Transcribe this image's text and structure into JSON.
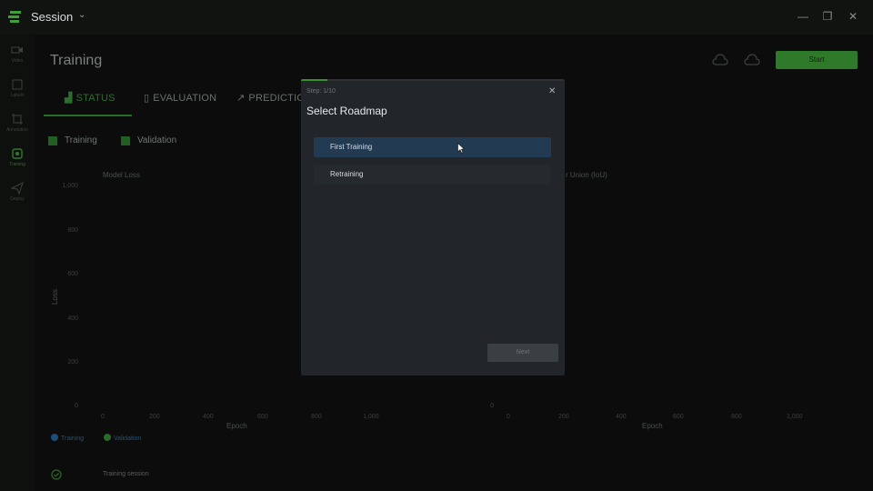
{
  "app": {
    "title": "Session"
  },
  "rail": {
    "items": [
      {
        "label": "Video"
      },
      {
        "label": "Labels"
      },
      {
        "label": "Annotation"
      },
      {
        "label": "Training"
      },
      {
        "label": "Deploy"
      }
    ]
  },
  "page": {
    "title": "Training",
    "start_label": "Start",
    "tabs": [
      {
        "label": "STATUS"
      },
      {
        "label": "EVALUATION"
      },
      {
        "label": "PREDICTION"
      }
    ],
    "filters": [
      {
        "label": "Training"
      },
      {
        "label": "Validation"
      }
    ]
  },
  "charts": {
    "left": {
      "title": "Model Loss",
      "ylabel": "Loss",
      "xlabel": "Epoch",
      "yticks": [
        "1,000",
        "800",
        "600",
        "400",
        "200",
        "0"
      ],
      "xticks": [
        "0",
        "200",
        "400",
        "600",
        "800",
        "1,000"
      ],
      "legend": [
        "Training",
        "Validation"
      ]
    },
    "right": {
      "title_fragment": "r Union (IoU)",
      "xlabel": "Epoch",
      "yticks": [
        "0"
      ],
      "xticks": [
        "0",
        "200",
        "400",
        "600",
        "800",
        "1,000"
      ]
    }
  },
  "footer": {
    "status": "Training session"
  },
  "modal": {
    "step": "Step: 1/10",
    "step_progress": 0.1,
    "title": "Select Roadmap",
    "options": [
      {
        "label": "First Training",
        "selected": true
      },
      {
        "label": "Retraining",
        "selected": false
      }
    ],
    "next_label": "Next"
  },
  "colors": {
    "accent_green": "#3a8f32",
    "selected_option": "#233b52",
    "modal_bg": "#22262b"
  }
}
